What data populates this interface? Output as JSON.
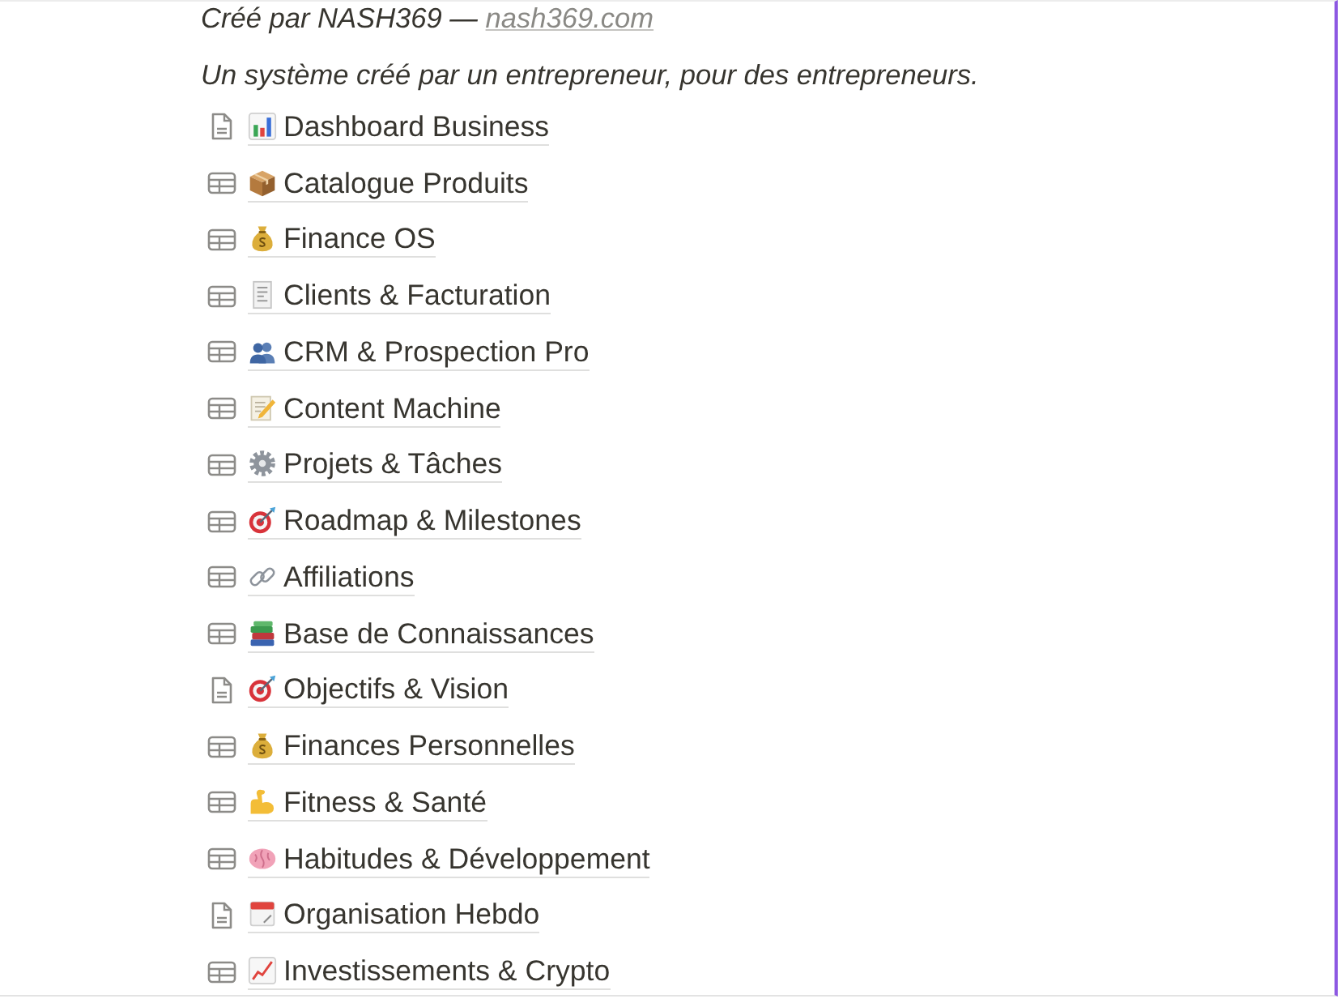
{
  "credit": {
    "text": "Créé par NASH369 —",
    "link": "nash369.com"
  },
  "tagline": "Un système créé par un entrepreneur, pour des entrepreneurs.",
  "pages": [
    {
      "kind": "page",
      "emoji": {
        "kind": "bar-chart"
      },
      "title": "Dashboard Business"
    },
    {
      "kind": "database",
      "emoji": {
        "kind": "package"
      },
      "title": "Catalogue Produits"
    },
    {
      "kind": "database",
      "emoji": {
        "kind": "money-bag"
      },
      "title": "Finance OS"
    },
    {
      "kind": "database",
      "emoji": {
        "kind": "receipt"
      },
      "title": "Clients & Facturation"
    },
    {
      "kind": "database",
      "emoji": {
        "kind": "people"
      },
      "title": "CRM & Prospection Pro"
    },
    {
      "kind": "database",
      "emoji": {
        "kind": "memo"
      },
      "title": "Content Machine"
    },
    {
      "kind": "database",
      "emoji": {
        "kind": "gear"
      },
      "title": "Projets & Tâches"
    },
    {
      "kind": "database",
      "emoji": {
        "kind": "target"
      },
      "title": "Roadmap & Milestones"
    },
    {
      "kind": "database",
      "emoji": {
        "kind": "chain-link"
      },
      "title": "Affiliations"
    },
    {
      "kind": "database",
      "emoji": {
        "kind": "books"
      },
      "title": "Base de Connaissances"
    },
    {
      "kind": "page",
      "emoji": {
        "kind": "target"
      },
      "title": "Objectifs & Vision"
    },
    {
      "kind": "database",
      "emoji": {
        "kind": "money-bag"
      },
      "title": "Finances Personnelles"
    },
    {
      "kind": "database",
      "emoji": {
        "kind": "flexed-arm"
      },
      "title": "Fitness & Santé"
    },
    {
      "kind": "database",
      "emoji": {
        "kind": "brain"
      },
      "title": "Habitudes & Développement"
    },
    {
      "kind": "page",
      "emoji": {
        "kind": "calendar"
      },
      "title": "Organisation Hebdo"
    },
    {
      "kind": "database",
      "emoji": {
        "kind": "rising-chart"
      },
      "title": "Investissements & Crypto"
    }
  ]
}
